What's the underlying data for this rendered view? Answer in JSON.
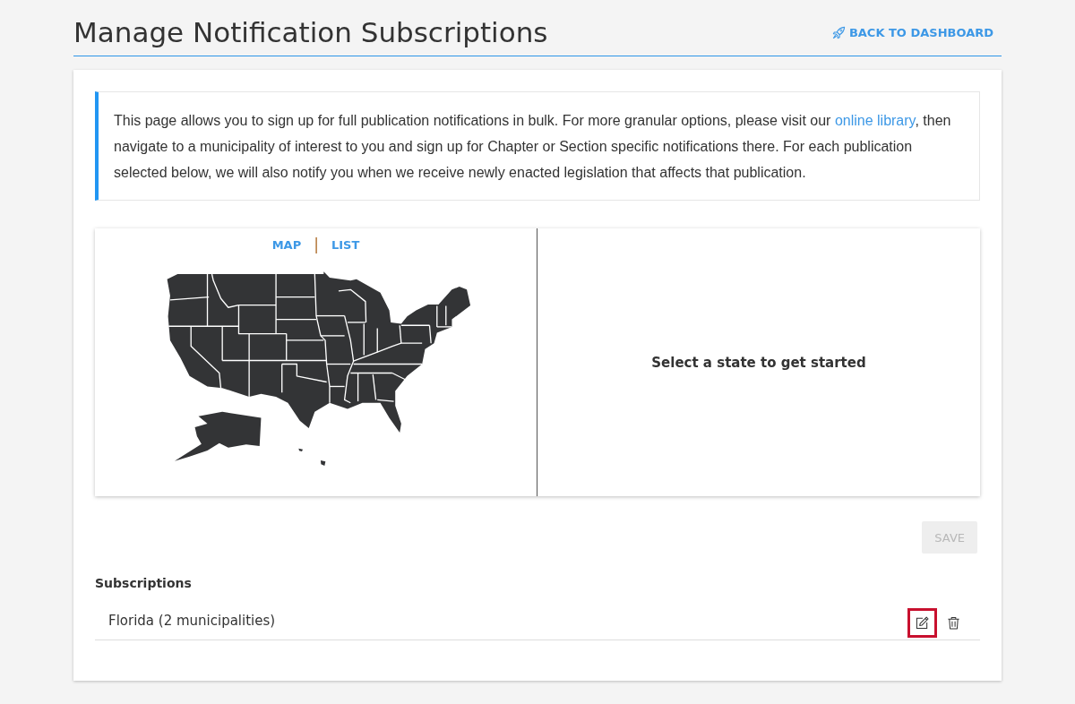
{
  "header": {
    "title": "Manage Notification Subscriptions",
    "back_link": {
      "label": "BACK TO DASHBOARD"
    }
  },
  "info": {
    "segments": [
      {
        "kind": "text",
        "text": "This page allows you to sign up for full publication notifications in bulk. For more granular options, please visit our "
      },
      {
        "kind": "link",
        "text": "online library"
      },
      {
        "kind": "text",
        "text": ", then navigate to a municipality of interest to you and sign up for Chapter or Section specific notifications there. For each publication selected below, we will also notify you when we receive newly enacted legislation that affects that publication."
      }
    ]
  },
  "map_panel": {
    "view_toggle": {
      "options": [
        {
          "label": "MAP"
        },
        {
          "label": "LIST"
        }
      ],
      "separator": "|"
    },
    "prompt": "Select a state to get started"
  },
  "save_button": {
    "label": "SAVE",
    "disabled": true
  },
  "subscriptions": {
    "heading": "Subscriptions",
    "items": [
      {
        "name": "Florida (2 municipalities)",
        "actions": [
          {
            "kind": "edit",
            "focused": true
          },
          {
            "kind": "delete",
            "focused": false
          }
        ]
      }
    ]
  }
}
